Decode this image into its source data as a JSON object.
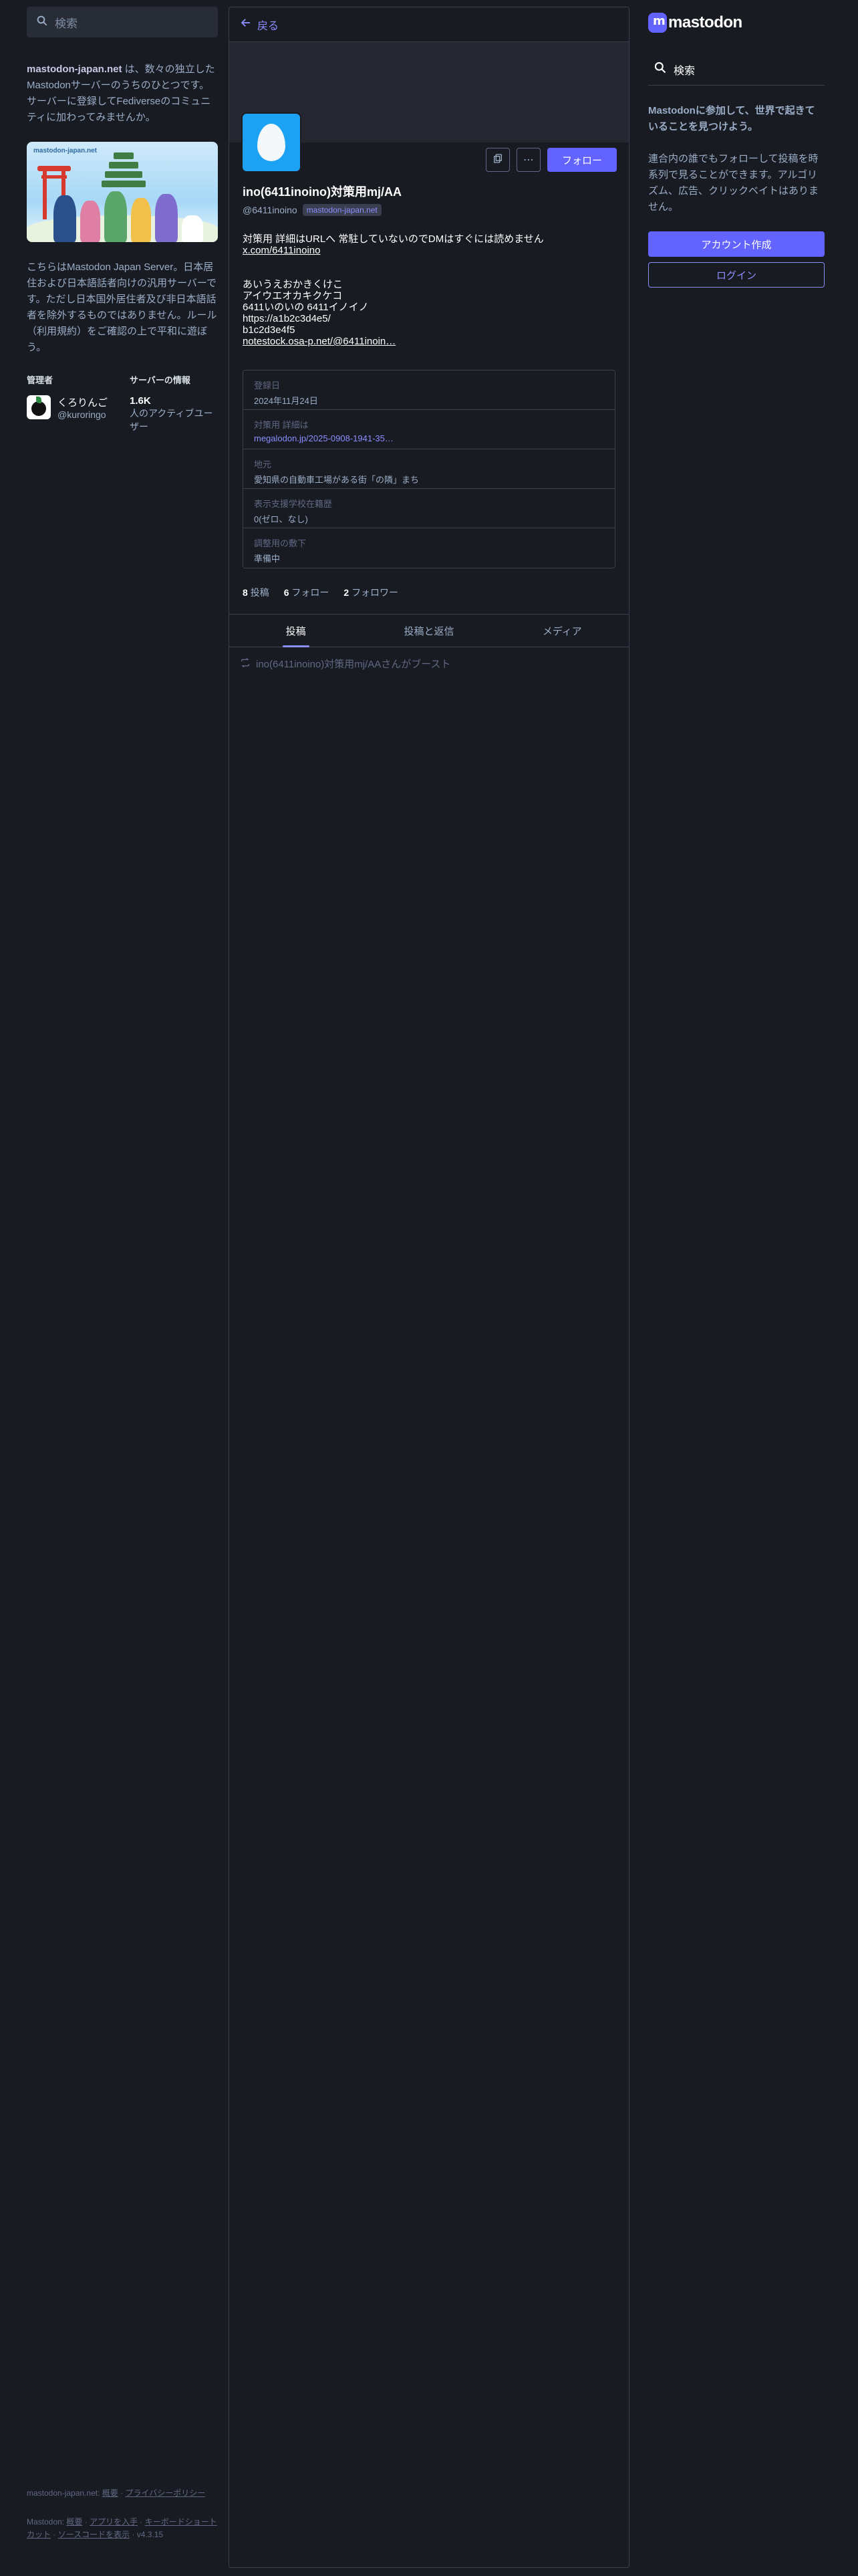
{
  "left": {
    "search_placeholder": "検索",
    "about_server": "mastodon-japan.net",
    "about_text": " は、数々の独立したMastodonサーバーのうちのひとつです。サーバーに登録してFediverseのコミュニティに加わってみませんか。",
    "hero_title": "mastodon-japan.net",
    "description": "こちらはMastodon Japan Server。日本居住および日本語話者向けの汎用サーバーです。ただし日本国外居住者及び非日本語話者を除外するものではありません。ルール（利用規約）をご確認の上で平和に遊ぼう。",
    "admin_heading": "管理者",
    "server_info_heading": "サーバーの情報",
    "admin_name": "くろりんご",
    "admin_handle": "@kuroringo",
    "active_users_count": "1.6K",
    "active_users_label": "人のアクティブユーザー",
    "footer": {
      "domain": "mastodon-japan.net",
      "sep1": ": ",
      "about": "概要",
      "dot1": " · ",
      "privacy": "プライバシーポリシー",
      "mastodon": "Mastodon",
      "sep2": ": ",
      "about2": "概要",
      "dot2": " · ",
      "get_app": "アプリを入手",
      "dot3": " · ",
      "shortcuts": "キーボードショートカット",
      "dot4": " · ",
      "source": "ソースコードを表示",
      "dot5": " · ",
      "version": "v4.3.15"
    }
  },
  "center": {
    "back_label": "戻る",
    "follow_label": "フォロー",
    "more_label": "⋯",
    "display_name": "ino(6411inoino)対策用mj/AA",
    "handle": "@6411inoino",
    "domain_badge": "mastodon-japan.net",
    "bio": {
      "line1": "対策用 詳細はURLへ 常駐していないのでDMはすぐには読めません",
      "link1": "x.com/6411inoino",
      "line3": "あいうえおかきくけこ",
      "line4": "アイウエオカキクケコ",
      "line5": "6411いのいの 6411イノイノ",
      "line6": "https://a1b2c3d4e5/",
      "line7": "b1c2d3e4f5",
      "link2": "notestock.osa-p.net/@6411inoin…"
    },
    "fields": [
      {
        "name": "登録日",
        "value": "2024年11月24日"
      },
      {
        "name": "対策用 詳細は",
        "value": "megalodon.jp/2025-0908-1941-35…"
      },
      {
        "name": "地元",
        "value": "愛知県の自動車工場がある街「の隣」まち"
      },
      {
        "name": "表示支援学校在籍歴",
        "value": "0(ゼロ、なし)"
      },
      {
        "name": "調整用の敷下",
        "value": "準備中"
      }
    ],
    "counts": {
      "posts_num": "8",
      "posts_label": "投稿",
      "following_num": "6",
      "following_label": "フォロー",
      "followers_num": "2",
      "followers_label": "フォロワー"
    },
    "tabs": [
      "投稿",
      "投稿と返信",
      "メディア"
    ],
    "boost_text": "ino(6411inoino)対策用mj/AAさんがブースト"
  },
  "right": {
    "logo_text": "mastodon",
    "search_label": "検索",
    "join_title": "Mastodonに参加して、世界で起きていることを見つけよう。",
    "join_text": "連合内の誰でもフォローして投稿を時系列で見ることができます。アルゴリズム、広告、クリックベイトはありません。",
    "signup_label": "アカウント作成",
    "login_label": "ログイン"
  }
}
